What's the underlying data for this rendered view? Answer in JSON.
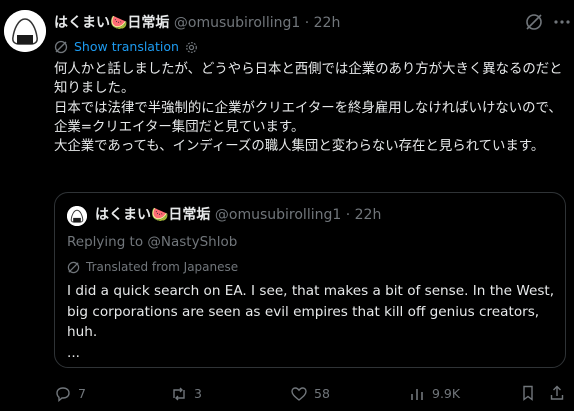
{
  "tweet": {
    "author_name": "はくまい🍉日常垢",
    "handle": "@omusubirolling1",
    "separator": "·",
    "time": "22h",
    "show_translation": "Show translation",
    "body": "何人かと話しましたが、どうやら日本と西側では企業のあり方が大きく異なるのだと知りました。\n日本では法律で半強制的に企業がクリエイターを終身雇用しなければいけないので、企業=クリエイター集団だと見ています。\n大企業であっても、インディーズの職人集団と変わらない存在と見られています。"
  },
  "quoted": {
    "author_name": "はくまい🍉日常垢",
    "handle": "@omusubirolling1",
    "separator": "·",
    "time": "22h",
    "replying_to": "Replying to @NastyShlob",
    "translated_from": "Translated from Japanese",
    "body": "I did a quick search on EA. I see, that makes a bit of sense. In the West, big corporations are seen as evil empires that kill off genius creators, huh.\n..."
  },
  "actions": {
    "replies": "7",
    "reposts": "3",
    "likes": "58",
    "views": "9.9K"
  },
  "icons": {
    "grok": "grok-icon",
    "more": "more-icon",
    "translate": "translate-icon",
    "settings": "gear-icon"
  },
  "colors": {
    "background": "#000000",
    "text": "#e7e9ea",
    "muted": "#71767b",
    "link": "#1d9bf0",
    "border": "#2f3336"
  }
}
